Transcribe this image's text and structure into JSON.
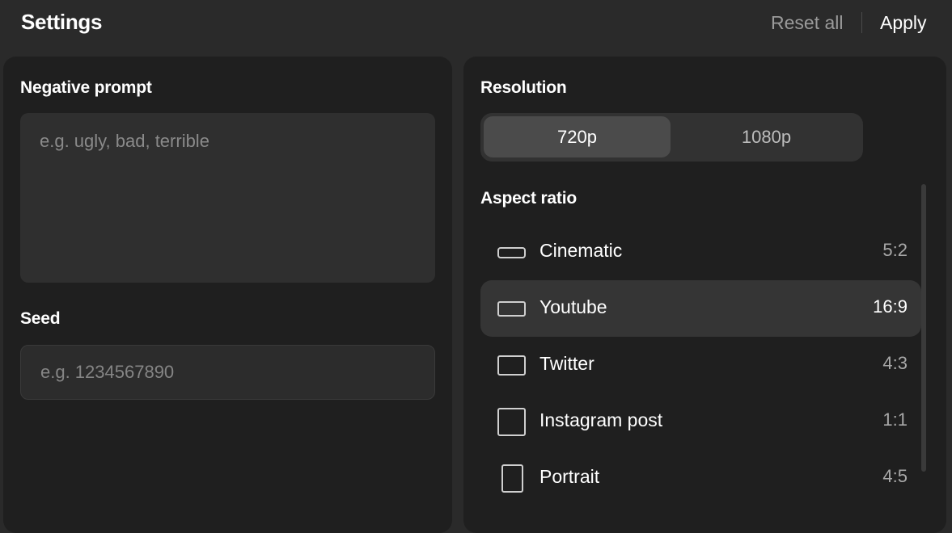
{
  "header": {
    "title": "Settings",
    "reset_label": "Reset all",
    "apply_label": "Apply"
  },
  "negative_prompt": {
    "label": "Negative prompt",
    "placeholder": "e.g. ugly, bad, terrible",
    "value": ""
  },
  "seed": {
    "label": "Seed",
    "placeholder": "e.g. 1234567890",
    "value": ""
  },
  "resolution": {
    "label": "Resolution",
    "options": [
      "720p",
      "1080p"
    ],
    "selected": "720p"
  },
  "aspect_ratio": {
    "label": "Aspect ratio",
    "selected": "Youtube",
    "items": [
      {
        "name": "Cinematic",
        "ratio": "5:2",
        "icon": "cinematic-ratio-icon"
      },
      {
        "name": "Youtube",
        "ratio": "16:9",
        "icon": "widescreen-ratio-icon"
      },
      {
        "name": "Twitter",
        "ratio": "4:3",
        "icon": "standard-ratio-icon"
      },
      {
        "name": "Instagram post",
        "ratio": "1:1",
        "icon": "square-ratio-icon"
      },
      {
        "name": "Portrait",
        "ratio": "4:5",
        "icon": "portrait-ratio-icon"
      }
    ]
  },
  "colors": {
    "background": "#2a2a2a",
    "panel": "#1f1f1f",
    "input": "#2f2f2f",
    "selected_row": "#353535",
    "segment_active": "#4b4b4b",
    "muted_text": "#9a9a9a"
  }
}
